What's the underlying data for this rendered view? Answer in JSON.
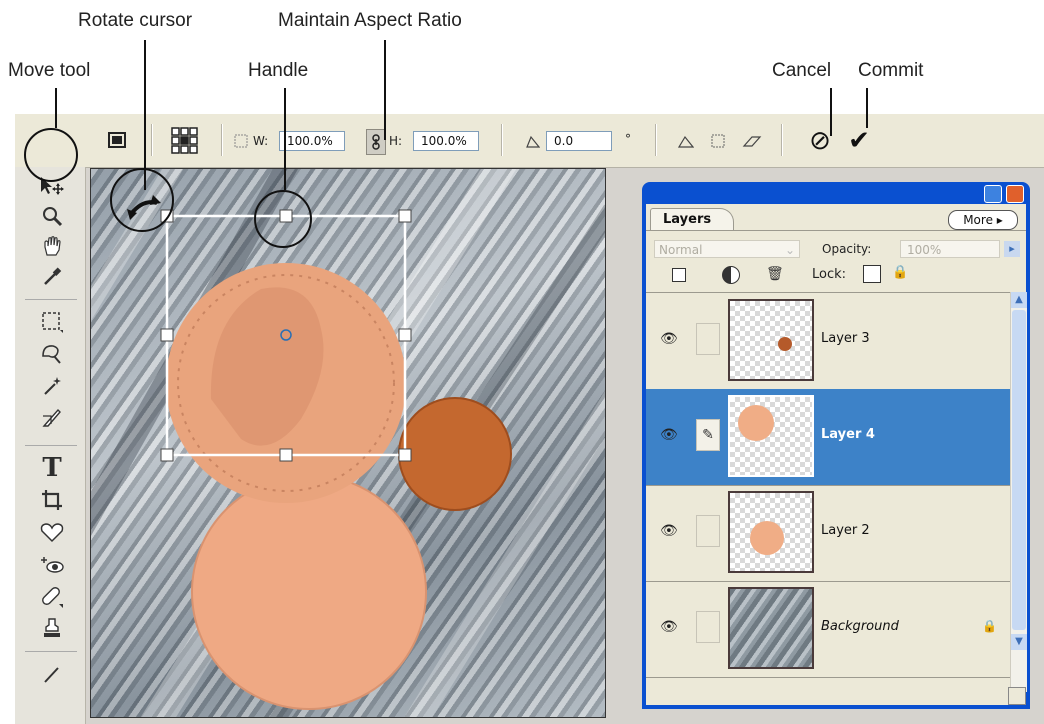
{
  "callouts": {
    "rotate_cursor": "Rotate cursor",
    "maintain_aspect_ratio": "Maintain Aspect Ratio",
    "move_tool": "Move tool",
    "handle": "Handle",
    "cancel": "Cancel",
    "commit": "Commit"
  },
  "options_bar": {
    "width_label": "W:",
    "width_value": "100.0%",
    "height_label": "H:",
    "height_value": "100.0%",
    "rotate_value": "0.0",
    "degree_symbol": "°",
    "cancel_icon": "⊘",
    "commit_icon": "✔"
  },
  "layers_panel": {
    "tab_label": "Layers",
    "more_label": "More",
    "blend_mode": "Normal",
    "opacity_label": "Opacity:",
    "opacity_value": "100%",
    "lock_label": "Lock:",
    "layers": [
      {
        "name": "Layer 3",
        "selected": false
      },
      {
        "name": "Layer 4",
        "selected": true
      },
      {
        "name": "Layer 2",
        "selected": false
      },
      {
        "name": "Background",
        "selected": false
      }
    ]
  },
  "colors": {
    "selection_blue": "#3d82c8",
    "title_blue": "#0a50d0",
    "coin_copper": "#e9a47d",
    "penny": "#c4682f"
  }
}
